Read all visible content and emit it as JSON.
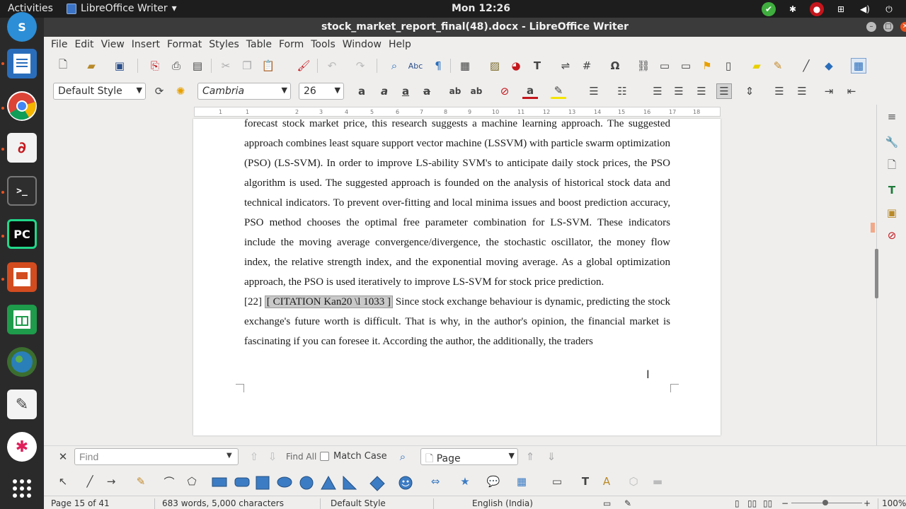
{
  "topbar": {
    "activities": "Activities",
    "app_name": "LibreOffice Writer",
    "app_menu_arrow": "▾",
    "clock": "Mon 12:26",
    "tray_icons": [
      "check-icon",
      "slack-icon",
      "record-icon",
      "network-icon",
      "volume-icon",
      "power-icon"
    ]
  },
  "dock": {
    "items": [
      "skype",
      "libreoffice-writer",
      "chrome",
      "mail",
      "terminal",
      "pycharm",
      "libreoffice-impress",
      "libreoffice-calc",
      "gimp",
      "text-editor",
      "slack",
      "show-applications"
    ],
    "labels": {
      "skype": "S",
      "pycharm": "PC",
      "terminal": ">_"
    }
  },
  "window": {
    "title": "stock_market_report_final(48).docx - LibreOffice Writer"
  },
  "menubar": [
    "File",
    "Edit",
    "View",
    "Insert",
    "Format",
    "Styles",
    "Table",
    "Form",
    "Tools",
    "Window",
    "Help"
  ],
  "format_toolbar": {
    "paragraph_style": "Default Style",
    "font_name": "Cambria",
    "font_size": "26"
  },
  "ruler": {
    "ticks": [
      "1",
      "1",
      "2",
      "3",
      "4",
      "5",
      "6",
      "7",
      "8",
      "9",
      "10",
      "11",
      "12",
      "13",
      "14",
      "15",
      "16",
      "17",
      "18"
    ]
  },
  "document": {
    "paragraph1": "forecast stock market price, this research suggests a machine learning approach. The suggested approach combines least square support vector machine (LSSVM) with particle swarm optimization (PSO) (LS-SVM). In order to improve LS-ability SVM's to anticipate daily stock prices, the PSO algorithm is used. The suggested approach is founded on the analysis of historical stock data and technical indicators. To prevent over-fitting and local minima issues and boost prediction accuracy, PSO method chooses the optimal free parameter combination for LS-SVM. These indicators include the moving average convergence/divergence, the stochastic oscillator, the money flow index, the relative strength index, and the exponential moving average. As a global optimization approach, the PSO is used iteratively to improve LS-SVM for stock price prediction.",
    "ref_number": "[22]",
    "citation_field": "[ CITATION Kan20 \\l 1033 ]",
    "paragraph2": "Since stock exchange behaviour is dynamic, predicting the stock exchange's future worth is difficult. That is why, in the author's opinion, the financial market is fascinating if you can foresee it. According the author, the additionally, the traders"
  },
  "findbar": {
    "placeholder": "Find",
    "find_all": "Find All",
    "match_case": "Match Case",
    "search_scope": "Page"
  },
  "statusbar": {
    "page": "Page 15 of 41",
    "words": "683 words, 5,000 characters",
    "style": "Default Style",
    "language": "English (India)",
    "zoom": "100%"
  },
  "colors": {
    "topbar": "#1d1d1d",
    "dock": "#2b2a2b",
    "titlebar": "#3b3b3b",
    "accent": "#e95420",
    "field_shading": "#c9c9c9"
  }
}
